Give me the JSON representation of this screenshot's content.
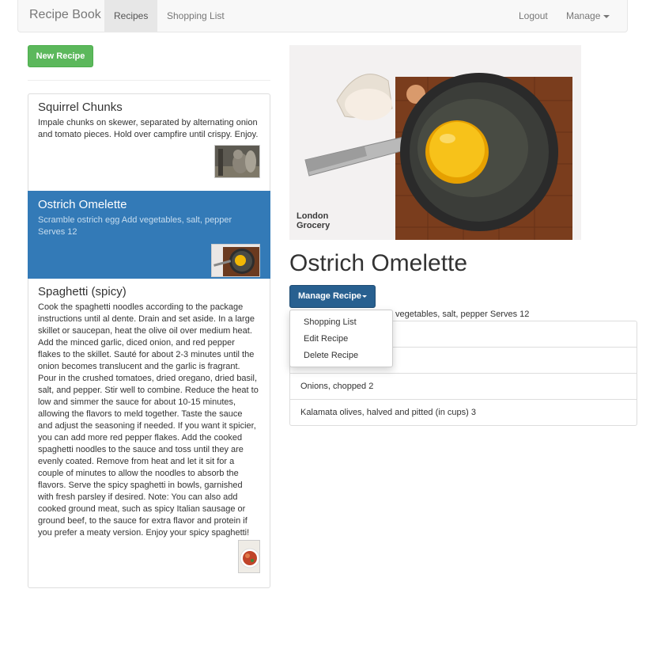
{
  "navbar": {
    "brand": "Recipe Book",
    "tabs": [
      "Recipes",
      "Shopping List"
    ],
    "logout": "Logout",
    "manage": "Manage"
  },
  "left": {
    "new_button": "New Recipe",
    "recipes": [
      {
        "title": "Squirrel Chunks",
        "description": "Impale chunks on skewer, separated by alternating onion and tomato pieces. Hold over campfire until crispy. Enjoy."
      },
      {
        "title": "Ostrich Omelette",
        "description": "Scramble ostrich egg Add vegetables, salt, pepper Serves 12"
      },
      {
        "title": "Spaghetti (spicy)",
        "description": "Cook the spaghetti noodles according to the package instructions until al dente. Drain and set aside. In a large skillet or saucepan, heat the olive oil over medium heat. Add the minced garlic, diced onion, and red pepper flakes to the skillet. Sauté for about 2-3 minutes until the onion becomes translucent and the garlic is fragrant. Pour in the crushed tomatoes, dried oregano, dried basil, salt, and pepper. Stir well to combine. Reduce the heat to low and simmer the sauce for about 10-15 minutes, allowing the flavors to meld together. Taste the sauce and adjust the seasoning if needed. If you want it spicier, you can add more red pepper flakes. Add the cooked spaghetti noodles to the sauce and toss until they are evenly coated. Remove from heat and let it sit for a couple of minutes to allow the noodles to absorb the flavors. Serve the spicy spaghetti in bowls, garnished with fresh parsley if desired. Note: You can also add cooked ground meat, such as spicy Italian sausage or ground beef, to the sauce for extra flavor and protein if you prefer a meaty version. Enjoy your spicy spaghetti!"
      }
    ]
  },
  "detail": {
    "logo_line1": "London",
    "logo_line2": "Grocery",
    "title": "Ostrich Omelette",
    "manage_button": "Manage Recipe",
    "description_visible": "vegetables, salt, pepper Serves 12",
    "dropdown": [
      "Shopping List",
      "Edit Recipe",
      "Delete Recipe"
    ],
    "ingredients": [
      "",
      "",
      "Onions, chopped 2",
      "Kalamata olives, halved and pitted (in cups) 3"
    ]
  },
  "colors": {
    "primary": "#337ab7",
    "success": "#5cb85c",
    "manage_btn": "#286090",
    "egg_yolk": "#f2b705"
  }
}
